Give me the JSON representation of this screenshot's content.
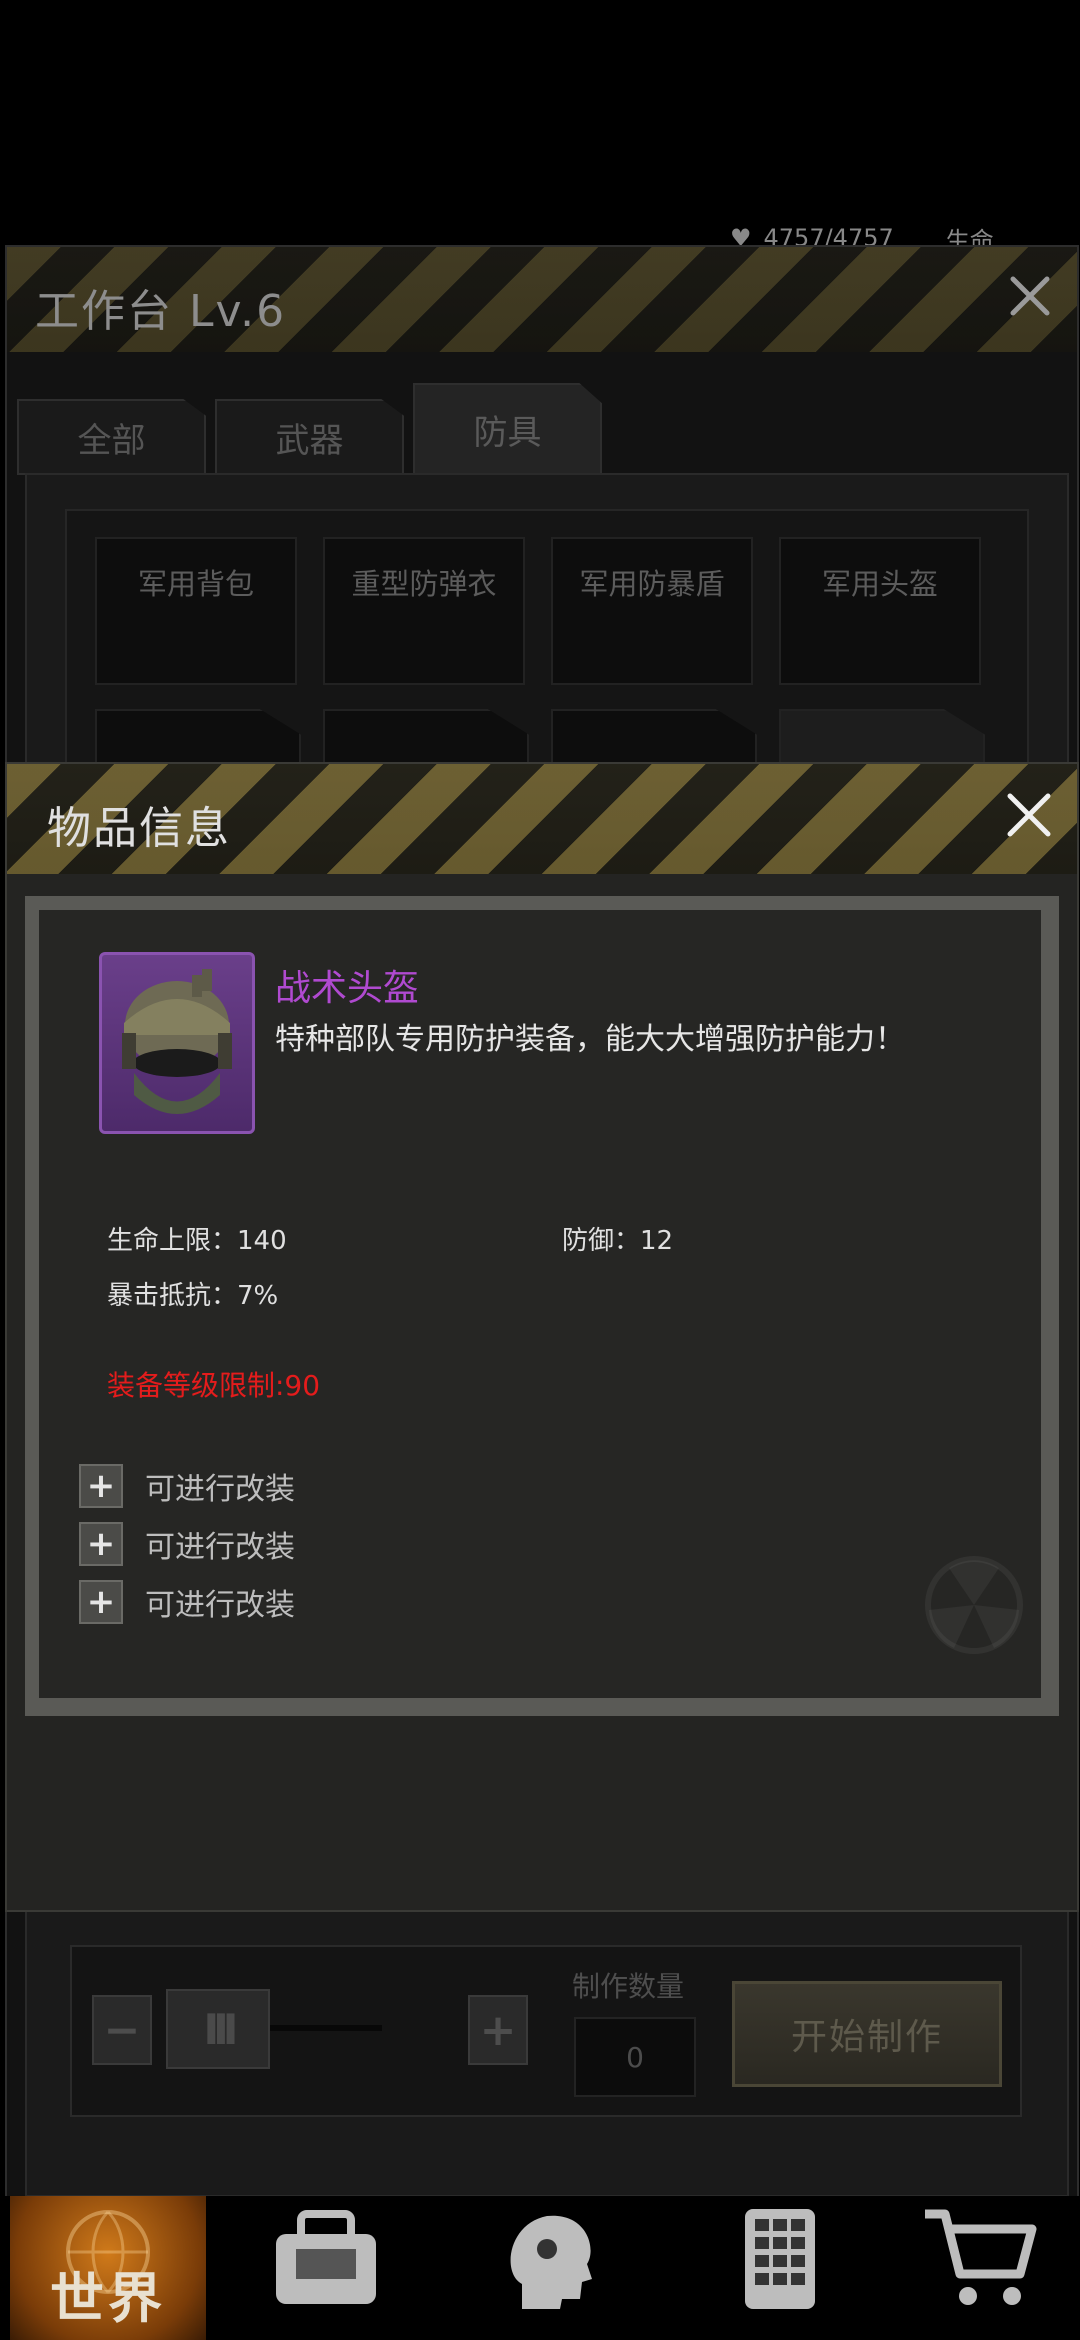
{
  "status": {
    "hp": "4757/4757",
    "label": "生命"
  },
  "workbench": {
    "title": "工作台 Lv.6",
    "tabs": [
      {
        "label": "全部"
      },
      {
        "label": "武器"
      },
      {
        "label": "防具"
      }
    ],
    "active_tab": "防具",
    "items": [
      {
        "label": "军用背包"
      },
      {
        "label": "重型防弹衣"
      },
      {
        "label": "军用防暴盾"
      },
      {
        "label": "军用头盔"
      }
    ],
    "craft": {
      "minus": "−",
      "plus": "+",
      "handle": "III",
      "quantity_label": "制作数量",
      "quantity": "0",
      "start_label": "开始制作"
    }
  },
  "item_info": {
    "title": "物品信息",
    "name": "战术头盔",
    "name_color": "#b04ad0",
    "description": "特种部队专用防护装备，能大大增强防护能力！",
    "stats": [
      {
        "text": "生命上限：140"
      },
      {
        "text": "防御：12"
      },
      {
        "text": "暴击抵抗：7%"
      }
    ],
    "requirement": "装备等级限制:90",
    "requirement_color": "#e41c1c",
    "mods": [
      {
        "label": "可进行改装"
      },
      {
        "label": "可进行改装"
      },
      {
        "label": "可进行改装"
      }
    ]
  },
  "nav": {
    "world_label": "世界",
    "icons": [
      "backpack-icon",
      "head-skill-icon",
      "phone-icon",
      "cart-icon"
    ]
  }
}
